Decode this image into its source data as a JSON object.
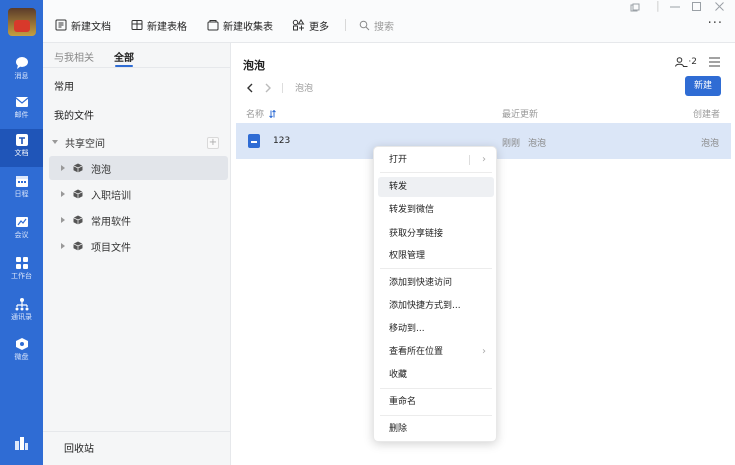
{
  "app": {
    "colors": {
      "accent": "#2f6cd4",
      "rail": "#2f6cd4",
      "row_selected": "#dbe6f7"
    }
  },
  "rail": {
    "items": [
      {
        "label": "消息",
        "icon": "chat-bubble-icon"
      },
      {
        "label": "邮件",
        "icon": "mail-icon"
      },
      {
        "label": "文档",
        "icon": "document-icon",
        "active": true
      },
      {
        "label": "日程",
        "icon": "calendar-icon"
      },
      {
        "label": "会议",
        "icon": "meeting-icon"
      },
      {
        "label": "工作台",
        "icon": "apps-grid-icon"
      },
      {
        "label": "通讯录",
        "icon": "contacts-icon"
      },
      {
        "label": "微盘",
        "icon": "drive-icon"
      }
    ]
  },
  "toolbar": {
    "new_doc": "新建文档",
    "new_sheet": "新建表格",
    "new_form": "新建收集表",
    "more": "更多",
    "search_placeholder": "搜索",
    "more_dots": "···"
  },
  "nav": {
    "tab_related": "与我相关",
    "tab_all": "全部",
    "common": "常用",
    "my_files": "我的文件",
    "shared_space": "共享空间",
    "plus": "+",
    "spaces": [
      "泡泡",
      "入职培训",
      "常用软件",
      "项目文件"
    ],
    "recycle": "回收站"
  },
  "main": {
    "title": "泡泡",
    "share_count": "·2",
    "breadcrumb": "泡泡",
    "new_button": "新建",
    "columns": {
      "name": "名称",
      "updated": "最近更新",
      "creator": "创建者"
    },
    "rows": [
      {
        "name": "123",
        "updated_time": "刚刚",
        "updated_by": "泡泡",
        "creator": "泡泡"
      }
    ]
  },
  "context_menu": {
    "items": [
      {
        "label": "打开"
      },
      {
        "label": "转发"
      },
      {
        "label": "转发到微信"
      },
      {
        "label": "获取分享链接"
      },
      {
        "label": "权限管理"
      },
      {
        "label": "添加到快速访问"
      },
      {
        "label": "添加快捷方式到..."
      },
      {
        "label": "移动到..."
      },
      {
        "label": "查看所在位置"
      },
      {
        "label": "收藏"
      },
      {
        "label": "重命名"
      },
      {
        "label": "删除"
      }
    ]
  }
}
